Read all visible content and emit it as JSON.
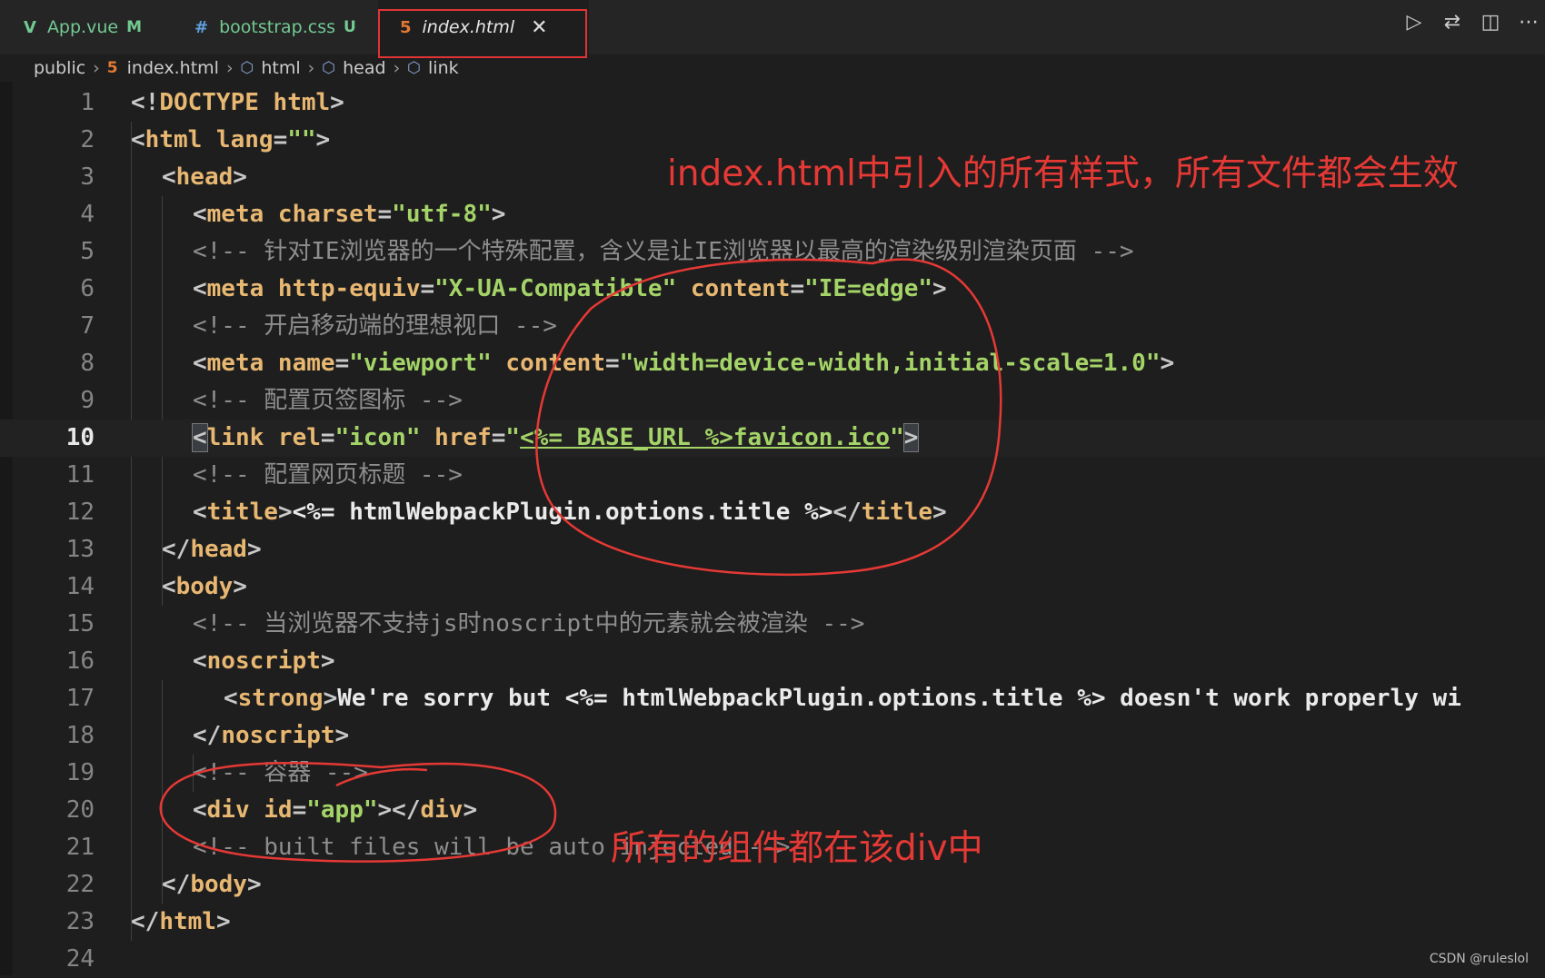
{
  "tabs": [
    {
      "icon": "V",
      "label": "App.vue",
      "status": "M"
    },
    {
      "icon": "#",
      "label": "bootstrap.css",
      "status": "U"
    },
    {
      "icon": "5",
      "label": "index.html",
      "close": "✕"
    }
  ],
  "breadcrumb": [
    "public",
    "index.html",
    "html",
    "head",
    "link"
  ],
  "annotations": {
    "top": "index.html中引入的所有样式，所有文件都会生效",
    "bottom": "所有的组件都在该div中"
  },
  "watermark": "CSDN @ruleslol",
  "colors": {
    "annotation": "#e53935",
    "tag": "#e8b872",
    "string": "#a4d468",
    "comment": "#8e8e8e"
  },
  "lines": [
    {
      "n": "1"
    },
    {
      "n": "2"
    },
    {
      "n": "3"
    },
    {
      "n": "4"
    },
    {
      "n": "5"
    },
    {
      "n": "6"
    },
    {
      "n": "7"
    },
    {
      "n": "8"
    },
    {
      "n": "9"
    },
    {
      "n": "10"
    },
    {
      "n": "11"
    },
    {
      "n": "12"
    },
    {
      "n": "13"
    },
    {
      "n": "14"
    },
    {
      "n": "15"
    },
    {
      "n": "16"
    },
    {
      "n": "17"
    },
    {
      "n": "18"
    },
    {
      "n": "19"
    },
    {
      "n": "20"
    },
    {
      "n": "21"
    },
    {
      "n": "22"
    },
    {
      "n": "23"
    },
    {
      "n": "24"
    }
  ],
  "code": {
    "l1": {
      "a": "<!",
      "b": "DOCTYPE",
      "c": " html",
      "d": ">"
    },
    "l2": {
      "a": "<",
      "b": "html",
      "c": " lang",
      "d": "=",
      "e": "\"\"",
      "f": ">"
    },
    "l3": {
      "a": "<",
      "b": "head",
      "c": ">"
    },
    "l4": {
      "a": "<",
      "b": "meta",
      "c": " charset",
      "d": "=",
      "e": "\"utf-8\"",
      "f": ">"
    },
    "l5": {
      "a": "<!-- 针对IE浏览器的一个特殊配置，含义是让IE浏览器以最高的渲染级别渲染页面 -->"
    },
    "l6": {
      "a": "<",
      "b": "meta",
      "c": " http-equiv",
      "d": "=",
      "e": "\"X-UA-Compatible\"",
      "f": " content",
      "g": "=",
      "h": "\"IE=edge\"",
      "i": ">"
    },
    "l7": {
      "a": "<!-- 开启移动端的理想视口 -->"
    },
    "l8": {
      "a": "<",
      "b": "meta",
      "c": " name",
      "d": "=",
      "e": "\"viewport\"",
      "f": " content",
      "g": "=",
      "h": "\"width=device-width,initial-scale=1.0\"",
      "i": ">"
    },
    "l9": {
      "a": "<!-- 配置页签图标 -->"
    },
    "l10": {
      "a": "<",
      "b": "link",
      "c": " rel",
      "d": "=",
      "e": "\"icon\"",
      "f": " href",
      "g": "=",
      "h": "\"",
      "i": "<%= BASE_URL %>favicon.ico",
      "j": "\"",
      "k": ">"
    },
    "l11": {
      "a": "<!-- 配置网页标题 -->"
    },
    "l12": {
      "a": "<",
      "b": "title",
      "c": ">",
      "d": "<%= htmlWebpackPlugin.options.title %>",
      "e": "</",
      "f": "title",
      "g": ">"
    },
    "l13": {
      "a": "</",
      "b": "head",
      "c": ">"
    },
    "l14": {
      "a": "<",
      "b": "body",
      "c": ">"
    },
    "l15": {
      "a": "<!-- 当浏览器不支持js时noscript中的元素就会被渲染 -->"
    },
    "l16": {
      "a": "<",
      "b": "noscript",
      "c": ">"
    },
    "l17": {
      "a": "<",
      "b": "strong",
      "c": ">",
      "d": "We're sorry but <%= htmlWebpackPlugin.options.title %> doesn't work properly wi"
    },
    "l18": {
      "a": "</",
      "b": "noscript",
      "c": ">"
    },
    "l19": {
      "a": "<!-- 容器 -->"
    },
    "l20": {
      "a": "<",
      "b": "div",
      "c": " id",
      "d": "=",
      "e": "\"app\"",
      "f": "></",
      "g": "div",
      "h": ">"
    },
    "l21": {
      "a": "<!-- built files will be auto injected -->"
    },
    "l22": {
      "a": "</",
      "b": "body",
      "c": ">"
    },
    "l23": {
      "a": "</",
      "b": "html",
      "c": ">"
    }
  }
}
